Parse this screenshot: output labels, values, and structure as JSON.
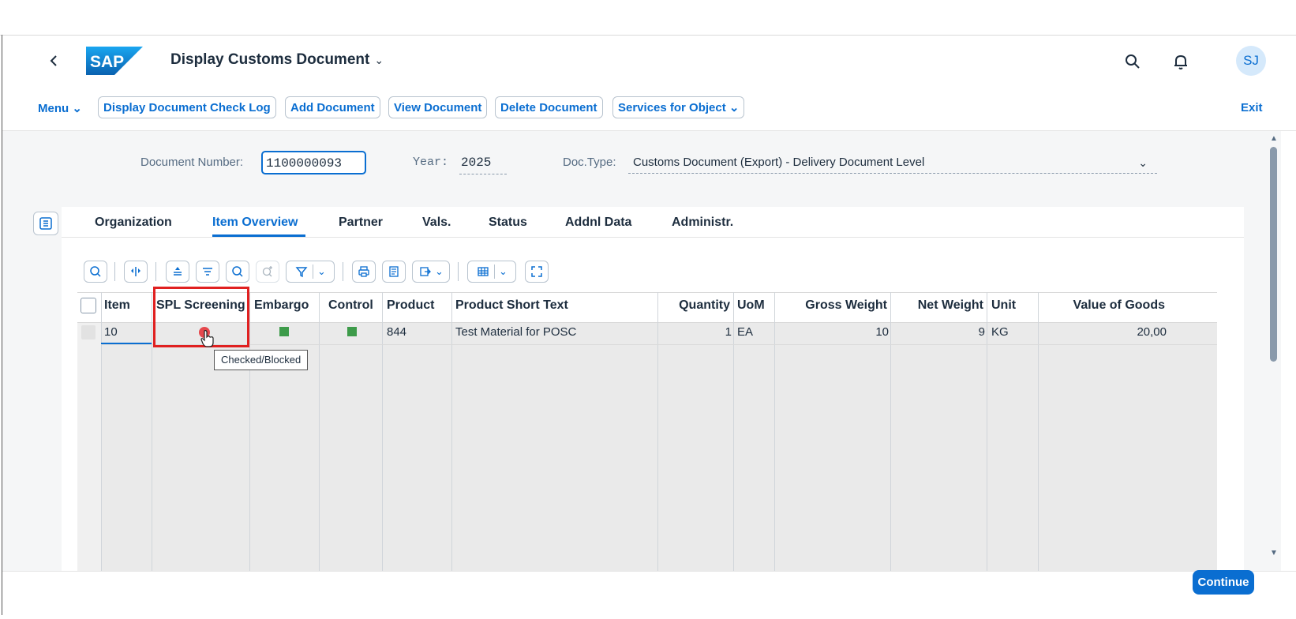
{
  "shell": {
    "back_icon": "chevron-left-icon",
    "logo_text": "SAP",
    "title": "Display Customs Document",
    "title_chevron": "chevron-down-icon",
    "search_icon": "search-icon",
    "notification_icon": "bell-icon",
    "avatar_initials": "SJ"
  },
  "toolbar": {
    "menu_label": "Menu",
    "buttons": [
      "Display Document Check Log",
      "Add Document",
      "View Document",
      "Delete Document",
      "Services for Object"
    ],
    "exit_label": "Exit"
  },
  "header_fields": {
    "doc_number_label": "Document Number:",
    "doc_number_value": "1100000093",
    "year_label": "Year:",
    "year_value": "2025",
    "doctype_label": "Doc.Type:",
    "doctype_value": "Customs Document (Export) - Delivery Document Level"
  },
  "tabs": [
    "Organization",
    "Item Overview",
    "Partner",
    "Vals.",
    "Status",
    "Addnl Data",
    "Administr."
  ],
  "active_tab": "Item Overview",
  "grid_toolbar_icons": [
    "zoom-details-icon",
    "compare-icon",
    "sort-ascending-icon",
    "sort-descending-icon",
    "find-icon",
    "find-next-icon",
    "filter-icon",
    "print-icon",
    "view-icon",
    "export-icon",
    "layout-icon",
    "fullscreen-icon"
  ],
  "table": {
    "columns": [
      "Item",
      "SPL Screening",
      "Embargo",
      "Control",
      "Product",
      "Product Short Text",
      "Quantity",
      "UoM",
      "Gross Weight",
      "Net Weight",
      "Unit",
      "Value of Goods"
    ],
    "rows": [
      {
        "item": "10",
        "spl_screening_status": "red",
        "embargo_status": "green",
        "control_status": "green",
        "product": "844",
        "product_short_text": "Test Material for POSC",
        "quantity": "1",
        "uom": "EA",
        "gross_weight": "10",
        "net_weight": "9",
        "unit": "KG",
        "value_of_goods": "20,00"
      }
    ]
  },
  "tooltip": "Checked/Blocked",
  "footer": {
    "continue_label": "Continue"
  },
  "colors": {
    "accent": "#0a6ed1",
    "status_red": "#e5484d",
    "status_green": "#3d9b4a",
    "highlight": "#e02020"
  }
}
